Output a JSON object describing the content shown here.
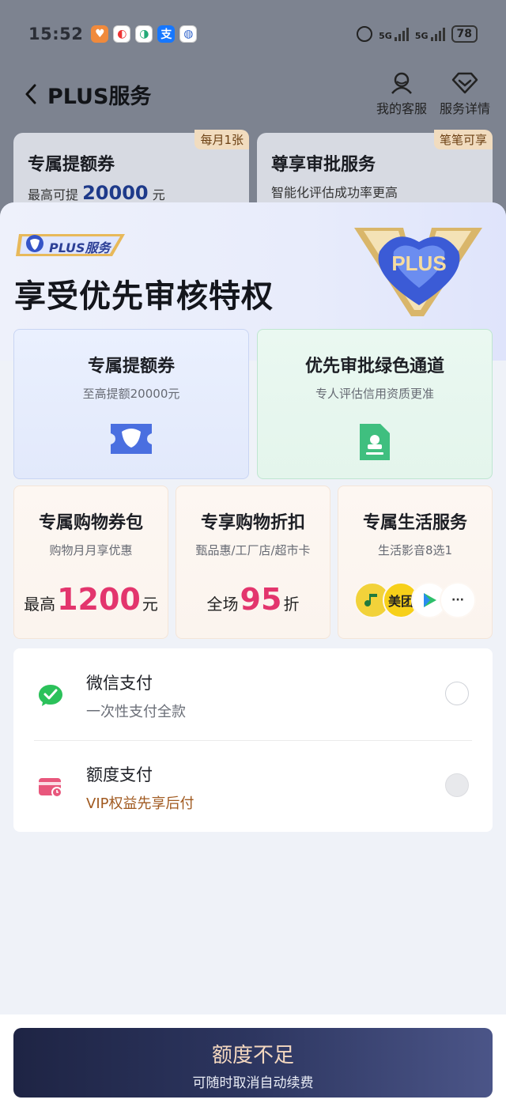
{
  "status_bar": {
    "time": "15:52",
    "network_1": "5G",
    "network_2": "5G",
    "battery": "78"
  },
  "header": {
    "title": "PLUS服务",
    "actions": [
      {
        "label": "我的客服"
      },
      {
        "label": "服务详情"
      }
    ]
  },
  "background_cards": [
    {
      "title": "专属提额券",
      "sub_prefix": "最高可提",
      "value": "20000",
      "sub_suffix": "元",
      "tag": "每月1张"
    },
    {
      "title": "尊享审批服务",
      "sub": "智能化评估成功率更高",
      "tag": "笔笔可享"
    }
  ],
  "sheet": {
    "badge": "PLUS服务",
    "gem_text": "PLUS",
    "title": "享受优先审核特权",
    "big_cards": [
      {
        "title": "专属提额券",
        "subtitle": "至高提额20000元",
        "icon": "ticket-icon"
      },
      {
        "title": "优先审批绿色通道",
        "subtitle": "专人评估信用资质更准",
        "icon": "document-stamp-icon"
      }
    ],
    "small_cards": [
      {
        "title": "专属购物券包",
        "subtitle": "购物月月享优惠",
        "prefix": "最高",
        "value": "1200",
        "suffix": "元"
      },
      {
        "title": "专享购物折扣",
        "subtitle": "甄品惠/工厂店/超市卡",
        "prefix": "全场",
        "value": "95",
        "suffix": "折"
      },
      {
        "title": "专属生活服务",
        "subtitle": "生活影音8选1",
        "apps": [
          "music-app-icon",
          "美团",
          "video-play-icon",
          "···"
        ]
      }
    ]
  },
  "payment": {
    "methods": [
      {
        "name": "微信支付",
        "desc": "一次性支付全款",
        "icon": "wechat-pay-icon",
        "selected": false,
        "enabled": true
      },
      {
        "name": "额度支付",
        "desc": "VIP权益先享后付",
        "icon": "credit-card-clock-icon",
        "selected": false,
        "enabled": false
      }
    ]
  },
  "cta": {
    "label": "额度不足",
    "sublabel": "可随时取消自动续费"
  },
  "colors": {
    "accent_red": "#e3356d",
    "cta_dark": "#1e2444",
    "plus_blue": "#2c3f96",
    "wechat_green": "#2bc15a"
  }
}
